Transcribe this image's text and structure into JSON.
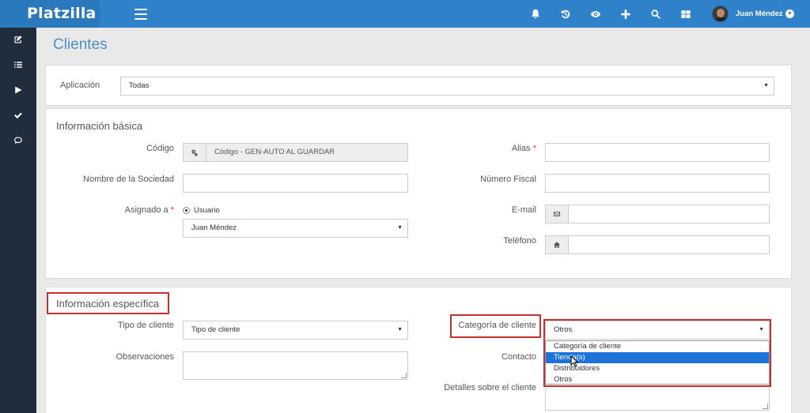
{
  "header": {
    "brand": "Platzilla",
    "user_name": "Juan Méndez",
    "icons": [
      "bell-icon",
      "history-icon",
      "eye-icon",
      "plus-icon",
      "search-icon",
      "grid-icon"
    ]
  },
  "sidebar": {
    "items": [
      "edit-icon",
      "list-icon",
      "play-icon",
      "check-icon",
      "chat-icon"
    ]
  },
  "page": {
    "title": "Clientes"
  },
  "application": {
    "label": "Aplicación",
    "value": "Todas"
  },
  "basic": {
    "title": "Información básica",
    "codigo_label": "Código",
    "codigo_value": "Código - GEN-AUTO AL GUARDAR",
    "alias_label": "Alias",
    "sociedad_label": "Nombre de la Sociedad",
    "fiscal_label": "Número Fiscal",
    "asignado_label": "Asignado a",
    "radio_label": "Usuario",
    "asignado_value": "Juan Méndez",
    "email_label": "E-mail",
    "telefono_label": "Teléfono",
    "required_mark": "*"
  },
  "specific": {
    "title": "Información específica",
    "tipo_label": "Tipo de cliente",
    "tipo_value": "Tipo de cliente",
    "observaciones_label": "Observaciones",
    "categoria_label": "Categoría de cliente",
    "categoria_value": "Otros",
    "contacto_label": "Contacto",
    "detalles_label": "Detalles sobre el cliente",
    "categoria_options": [
      "Categoría de cliente",
      "Tienda(s)",
      "Distribuidores",
      "Otros"
    ],
    "highlighted_option": "Tienda(s)"
  },
  "colors": {
    "topbar": "#2f82c9",
    "sidebar": "#1f2d3d",
    "highlight": "#c9302c",
    "selected_option": "#1e73d8"
  }
}
